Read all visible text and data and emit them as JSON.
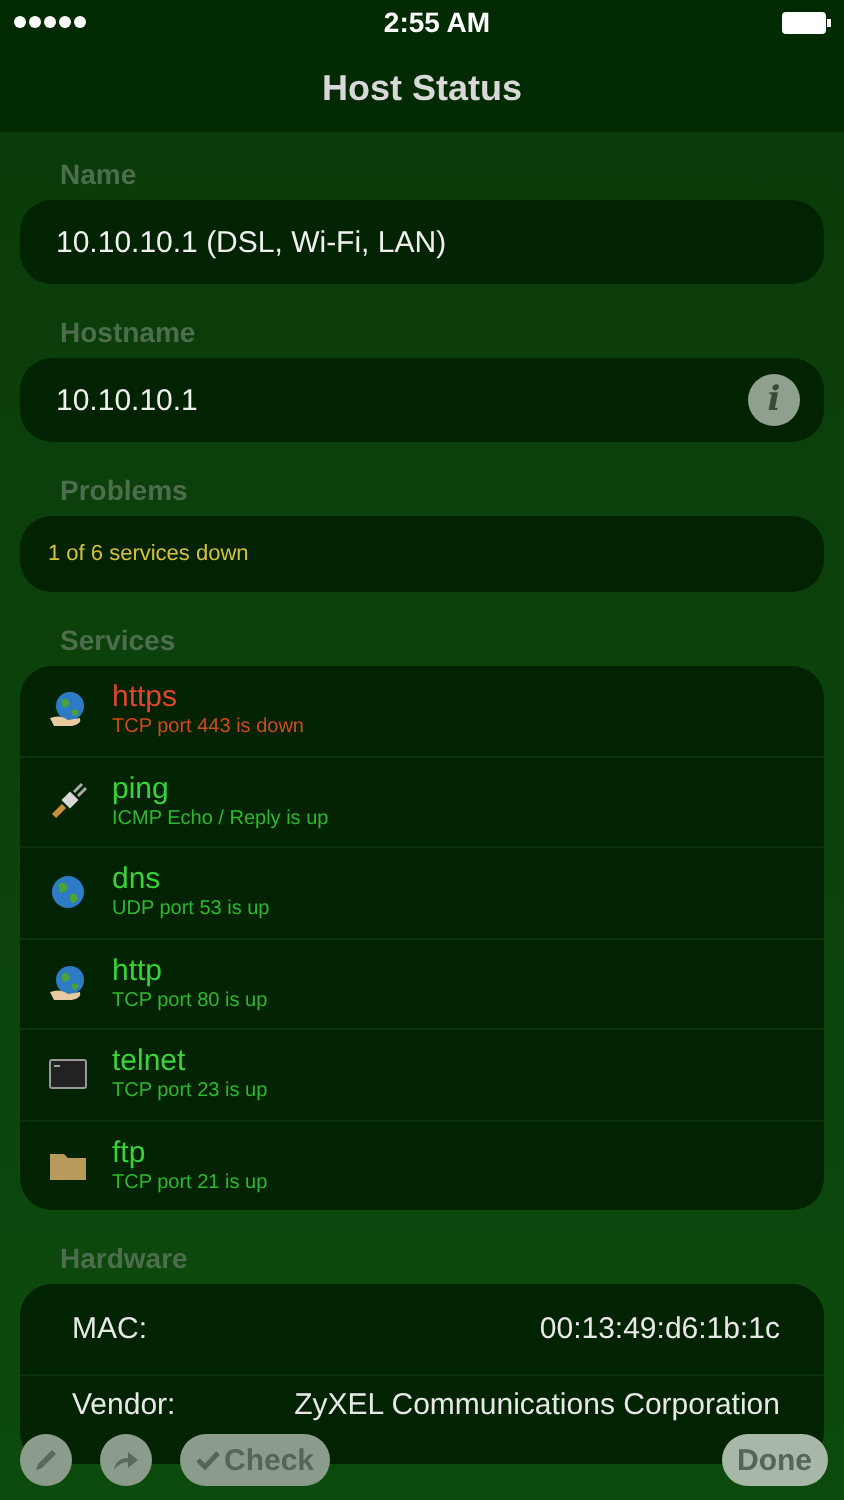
{
  "status_bar": {
    "time": "2:55 AM"
  },
  "nav": {
    "title": "Host Status"
  },
  "name_section": {
    "header": "Name",
    "value": "10.10.10.1 (DSL, Wi-Fi, LAN)"
  },
  "hostname_section": {
    "header": "Hostname",
    "value": "10.10.10.1",
    "info_button": "i"
  },
  "problems_section": {
    "header": "Problems",
    "value": "1 of 6 services down"
  },
  "services_section": {
    "header": "Services",
    "items": [
      {
        "kind": "globe-hand",
        "name": "https",
        "detail": "TCP port 443 is down",
        "down": true
      },
      {
        "kind": "plug",
        "name": "ping",
        "detail": "ICMP Echo / Reply is up",
        "down": false
      },
      {
        "kind": "globe",
        "name": "dns",
        "detail": "UDP port 53 is up",
        "down": false
      },
      {
        "kind": "globe-hand",
        "name": "http",
        "detail": "TCP port 80 is up",
        "down": false
      },
      {
        "kind": "terminal",
        "name": "telnet",
        "detail": "TCP port 23 is up",
        "down": false
      },
      {
        "kind": "folder",
        "name": "ftp",
        "detail": "TCP port 21 is up",
        "down": false
      }
    ]
  },
  "hardware_section": {
    "header": "Hardware",
    "rows": [
      {
        "label": "MAC:",
        "value": "00:13:49:d6:1b:1c"
      },
      {
        "label": "Vendor:",
        "value": "ZyXEL Communications Corporation"
      }
    ]
  },
  "toolbar": {
    "check": "Check",
    "done": "Done"
  }
}
